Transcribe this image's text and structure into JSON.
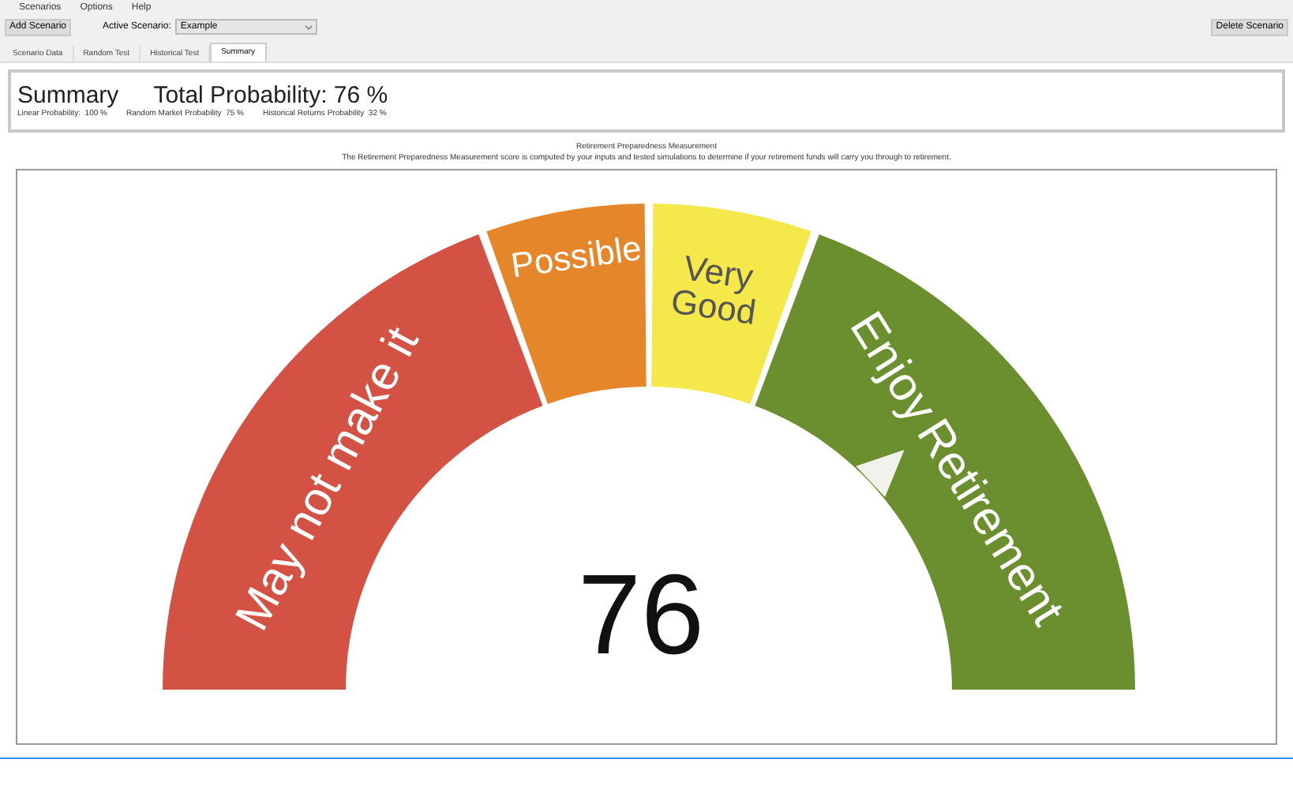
{
  "menu": [
    "Scenarios",
    "Options",
    "Help"
  ],
  "toolbar": {
    "add_button": "Add Scenario",
    "active_label": "Active Scenario:",
    "active_value": "Example",
    "delete_button": "Delete Scenario"
  },
  "tabs": [
    {
      "label": "Scenario Data",
      "selected": false
    },
    {
      "label": "Random Test",
      "selected": false
    },
    {
      "label": "Historical Test",
      "selected": false
    },
    {
      "label": "Summary",
      "selected": true
    }
  ],
  "summary": {
    "title": "Summary",
    "total": "Total Probability: 76 %",
    "details": [
      "Linear Probability:  100 %",
      "Random Market Probability  75 %",
      "Historical Returns Probability  32 %"
    ]
  },
  "measurement": {
    "title": "Retirement Preparedness Measurement",
    "description": "The Retirement Preparedness Measurement score is computed by your inputs and tested simulations to determine if your retirement funds will carry you through to retirement."
  },
  "gauge": {
    "score": "76",
    "segments": [
      {
        "label": "May not make it",
        "color": "#d35244"
      },
      {
        "label": "Possible",
        "color": "#e5862b"
      },
      {
        "label": "Very Good",
        "color": "#f4e84a"
      },
      {
        "label": "Enjoy Retirement",
        "color": "#6b8e2e"
      }
    ]
  }
}
